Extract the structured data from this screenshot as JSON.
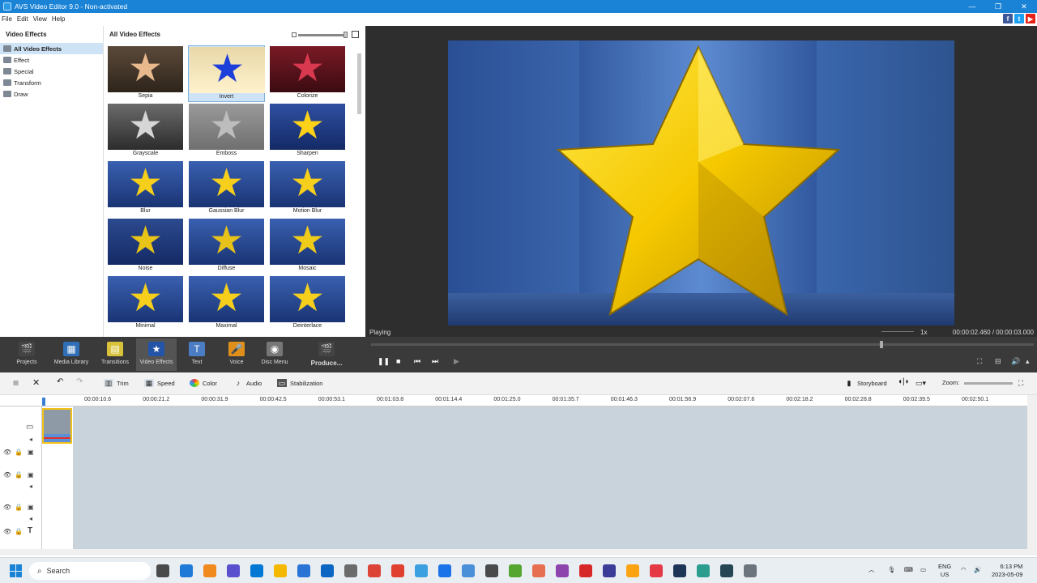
{
  "window": {
    "title": "AVS Video Editor 9.0 - Non-activated",
    "controls": [
      "—",
      "❐",
      "✕"
    ]
  },
  "menu": [
    "File",
    "Edit",
    "View",
    "Help"
  ],
  "social": [
    {
      "label": "f",
      "color": "#3b5998"
    },
    {
      "label": "t",
      "color": "#1da1f2"
    },
    {
      "label": "▶",
      "color": "#e62117"
    }
  ],
  "left_panel": {
    "header": "Video Effects",
    "items": [
      "All Video Effects",
      "Effect",
      "Special",
      "Transform",
      "Draw"
    ]
  },
  "effects_panel": {
    "header": "All Video Effects",
    "effects": [
      {
        "label": "Sepia",
        "bg": "linear-gradient(#5b4a3a,#2e241b)",
        "star": "#e7b98d"
      },
      {
        "label": "Invert",
        "bg": "linear-gradient(#e8d8a8,#fff2cc)",
        "star": "#1c3fd9"
      },
      {
        "label": "Colorize",
        "bg": "linear-gradient(#7a1a26,#3b0b12)",
        "star": "#d9394f"
      },
      {
        "label": "Grayscale",
        "bg": "linear-gradient(#6b6b6b,#2c2c2c)",
        "star": "#d6d6d6"
      },
      {
        "label": "Emboss",
        "bg": "linear-gradient(#9a9a9a,#6f6f6f)",
        "star": "#bdbdbd"
      },
      {
        "label": "Sharpen",
        "bg": "linear-gradient(#2f4fa0,#142a66)",
        "star": "#ffd21a"
      },
      {
        "label": "Blur",
        "bg": "linear-gradient(#3a60b0,#1a3474)",
        "star": "#f5cf1c"
      },
      {
        "label": "Gaussian Blur",
        "bg": "linear-gradient(#3a60b0,#1a3474)",
        "star": "#f5cf1c"
      },
      {
        "label": "Motion Blur",
        "bg": "linear-gradient(#3a60b0,#1a3474)",
        "star": "#f5cf1c"
      },
      {
        "label": "Noise",
        "bg": "linear-gradient(#2c4a8e,#142a66)",
        "star": "#e8c418"
      },
      {
        "label": "Diffuse",
        "bg": "linear-gradient(#3a60b0,#1a3474)",
        "star": "#e6c21a"
      },
      {
        "label": "Mosaic",
        "bg": "linear-gradient(#3a60b0,#1a3474)",
        "star": "#f0cc1a"
      },
      {
        "label": "Minimal",
        "bg": "linear-gradient(#3a60b0,#1a3474)",
        "star": "#f5cf1c"
      },
      {
        "label": "Maximal",
        "bg": "linear-gradient(#3a60b0,#1a3474)",
        "star": "#f5cf1c"
      },
      {
        "label": "Deinterlace",
        "bg": "linear-gradient(#3a60b0,#1a3474)",
        "star": "#f5cf1c"
      }
    ]
  },
  "preview": {
    "status": "Playing",
    "speed": "1x",
    "timecode": "00:00:02.460  /  00:00:03.000"
  },
  "toolbar": {
    "tools": [
      {
        "label": "Projects",
        "icon": "🎬",
        "color": "#444",
        "name": "projects"
      },
      {
        "label": "Media Library",
        "icon": "▦",
        "color": "#2f6fb8",
        "name": "media-library"
      },
      {
        "label": "Transitions",
        "icon": "▤",
        "color": "#d7c23a",
        "name": "transitions"
      },
      {
        "label": "Video Effects",
        "icon": "★",
        "color": "#2454a8",
        "name": "video-effects"
      },
      {
        "label": "Text",
        "icon": "T",
        "color": "#4a7dc4",
        "name": "text"
      },
      {
        "label": "Voice",
        "icon": "🎤",
        "color": "#e0901a",
        "name": "voice"
      },
      {
        "label": "Disc Menu",
        "icon": "◉",
        "color": "#777",
        "name": "disc-menu"
      },
      {
        "label": "Produce...",
        "icon": "🎬",
        "color": "#444",
        "name": "produce"
      }
    ],
    "playback": {
      "pause": "❚❚",
      "stop": "■",
      "prev": "⏮",
      "next": "⏭",
      "volume": "▶"
    },
    "right": [
      "⛶",
      "⊟",
      "🔊",
      "▴"
    ]
  },
  "edit_tools": {
    "trim": "Trim",
    "speed": "Speed",
    "color": "Color",
    "audio": "Audio",
    "stabilization": "Stabilization",
    "storyboard": "Storyboard",
    "zoom": "Zoom:"
  },
  "ruler": [
    "00:00:10.6",
    "00:00:21.2",
    "00:00:31.9",
    "00:00:42.5",
    "00:00:53.1",
    "00:01:03.8",
    "00:01:14.4",
    "00:01:25.0",
    "00:01:35.7",
    "00:01:46.3",
    "00:01:56.9",
    "00:02:07.6",
    "00:02:18.2",
    "00:02:28.8",
    "00:02:39.5",
    "00:02:50.1"
  ],
  "taskbar": {
    "search": "Search",
    "icons": [
      "#4a4a4a",
      "#1e7ad6",
      "#f08a1e",
      "#5a4fcf",
      "#0078d4",
      "#f5b800",
      "#2a74d6",
      "#0a66c2",
      "#6b6b6b",
      "#db4437",
      "#e0402f",
      "#3aa0e0",
      "#1a73e8",
      "#4a90d9",
      "#4a4a4a",
      "#55a630",
      "#e76f51",
      "#8e44ad",
      "#d62828",
      "#3b3b98",
      "#fca311",
      "#e63946",
      "#1d3557",
      "#2a9d8f",
      "#264653",
      "#6c757d"
    ],
    "lang": "ENG",
    "region": "US",
    "time": "6:13 PM",
    "date": "2023-05-09"
  }
}
